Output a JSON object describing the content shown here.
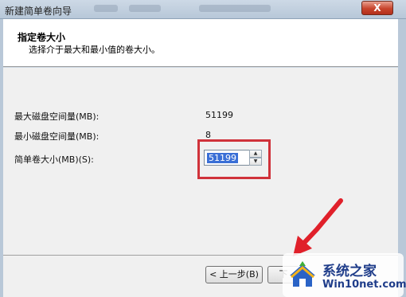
{
  "window": {
    "title": "新建简单卷向导",
    "close_label": "X"
  },
  "header": {
    "title": "指定卷大小",
    "subtitle": "选择介于最大和最小值的卷大小。"
  },
  "fields": {
    "max_label": "最大磁盘空间量(MB):",
    "max_value": "51199",
    "min_label": "最小磁盘空间量(MB):",
    "min_value": "8",
    "size_label": "简单卷大小(MB)(S):",
    "size_value": "51199"
  },
  "footer": {
    "back_label": "< 上一步(B)",
    "next_label": "下"
  },
  "watermark": {
    "main": "系统之家",
    "sub": "Win10net.com"
  },
  "colors": {
    "highlight": "#d0323a",
    "selection": "#3a6fd6",
    "arrow": "#e0202a"
  }
}
